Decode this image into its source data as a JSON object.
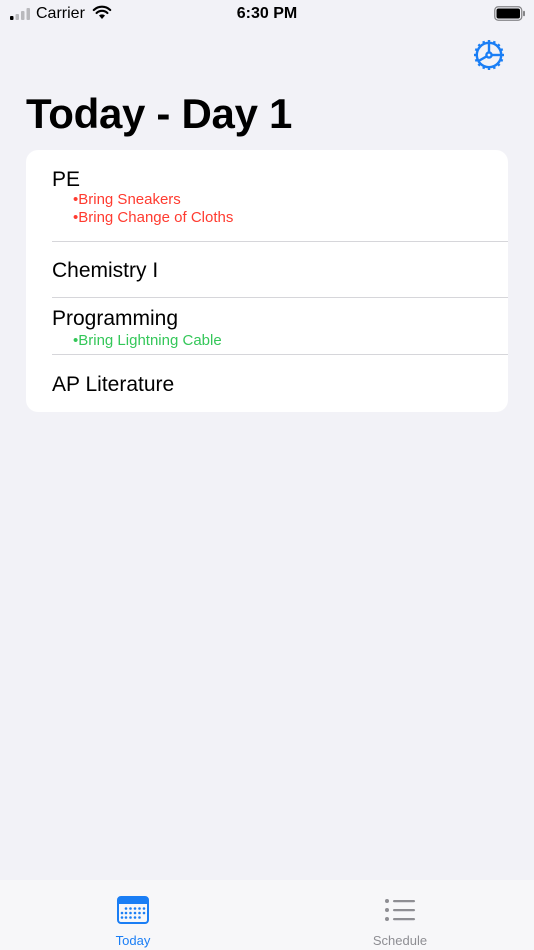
{
  "status_bar": {
    "carrier": "Carrier",
    "time": "6:30 PM"
  },
  "header": {
    "title": "Today - Day 1",
    "settings_icon": "gear-icon"
  },
  "classes": [
    {
      "name": "PE",
      "notes": [
        "•Bring Sneakers",
        "•Bring Change of Cloths"
      ],
      "note_color": "#ff3b30"
    },
    {
      "name": "Chemistry I",
      "notes": []
    },
    {
      "name": "Programming",
      "notes": [
        "•Bring Lightning Cable"
      ],
      "note_color": "#34c759"
    },
    {
      "name": "AP Literature",
      "notes": []
    }
  ],
  "tab_bar": {
    "tabs": [
      {
        "label": "Today",
        "icon": "calendar-icon",
        "selected": true,
        "color": "#1a7ef5"
      },
      {
        "label": "Schedule",
        "icon": "list-icon",
        "selected": false,
        "color": "#8e8e93"
      }
    ]
  },
  "colors": {
    "accent": "#1a7ef5",
    "background": "#f2f2f7"
  }
}
